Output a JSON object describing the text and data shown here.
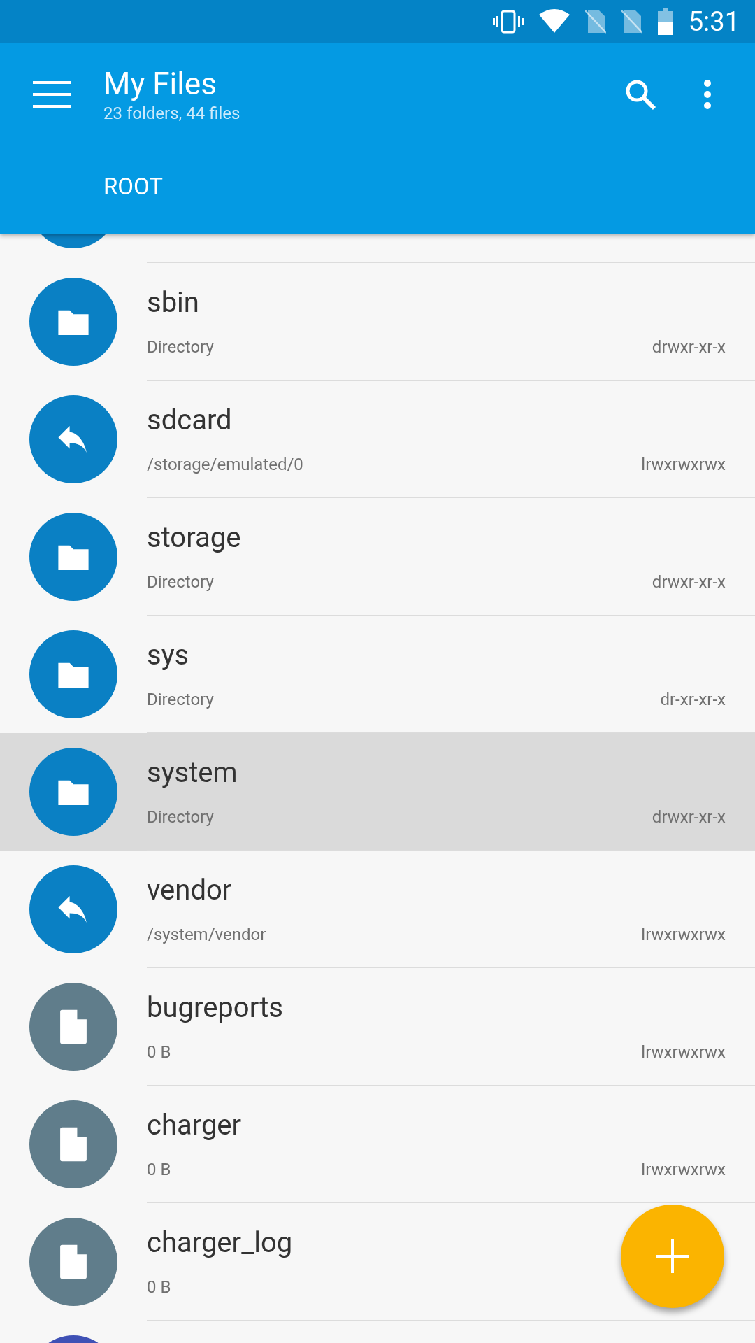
{
  "status_bar": {
    "time": "5:31"
  },
  "app_bar": {
    "title": "My Files",
    "subtitle": "23 folders, 44 files",
    "breadcrumb": "ROOT"
  },
  "files": [
    {
      "kind": "covered",
      "selected": false
    },
    {
      "kind": "folder",
      "name": "sbin",
      "subtitle": "Directory",
      "permissions": "drwxr-xr-x",
      "selected": false
    },
    {
      "kind": "link",
      "name": "sdcard",
      "subtitle": "/storage/emulated/0",
      "permissions": "lrwxrwxrwx",
      "selected": false
    },
    {
      "kind": "folder",
      "name": "storage",
      "subtitle": "Directory",
      "permissions": "drwxr-xr-x",
      "selected": false
    },
    {
      "kind": "folder",
      "name": "sys",
      "subtitle": "Directory",
      "permissions": "dr-xr-xr-x",
      "selected": false
    },
    {
      "kind": "folder",
      "name": "system",
      "subtitle": "Directory",
      "permissions": "drwxr-xr-x",
      "selected": true
    },
    {
      "kind": "link",
      "name": "vendor",
      "subtitle": "/system/vendor",
      "permissions": "lrwxrwxrwx",
      "selected": false
    },
    {
      "kind": "file",
      "name": "bugreports",
      "subtitle": "0 B",
      "permissions": "lrwxrwxrwx",
      "selected": false
    },
    {
      "kind": "file",
      "name": "charger",
      "subtitle": "0 B",
      "permissions": "lrwxrwxrwx",
      "selected": false
    },
    {
      "kind": "file",
      "name": "charger_log",
      "subtitle": "0 B",
      "selected": false
    },
    {
      "kind": "other",
      "selected": false
    }
  ]
}
